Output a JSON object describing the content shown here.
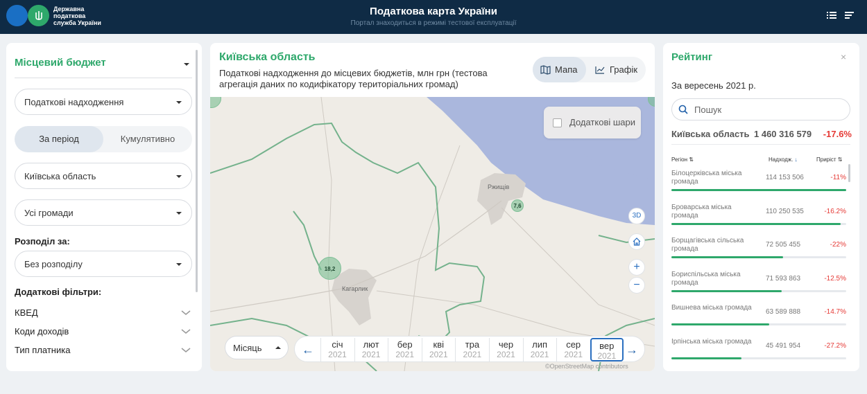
{
  "header": {
    "logo_text": "Державна\nподаткова\nслужба України",
    "title": "Податкова карта України",
    "subtitle": "Портал знаходиться в режимі тестової експлуатації",
    "icons": [
      "trident-icon",
      "list-icon",
      "menu-icon"
    ]
  },
  "left": {
    "budget_label": "Місцевий бюджет",
    "income_select": "Податкові надходження",
    "period_label": "За період",
    "cumulative_label": "Кумулятивно",
    "region_select": "Київська область",
    "communities_select": "Усі громади",
    "split_label": "Розподіл за:",
    "split_select": "Без розподілу",
    "extra_filters_label": "Додаткові фільтри:",
    "filters": [
      "КВЕД",
      "Коди доходів",
      "Тип платника"
    ]
  },
  "center": {
    "title": "Київська область",
    "description": "Податкові надходження до місцевих бюджетів, млн грн (тестова агрегація даних по кодифікатору територіальних громад)",
    "map_label": "Мапа",
    "chart_label": "Графік",
    "extra_layers_label": "Додаткові шари",
    "btn_3d": "3D",
    "zoom_in": "+",
    "zoom_out": "−",
    "clusters": [
      {
        "value": "18,2"
      },
      {
        "value": "7,6"
      }
    ],
    "cities": [
      "Ржищів",
      "Кагарлик"
    ],
    "period_select": "Місяць",
    "months": [
      {
        "m": "січ",
        "y": "2021"
      },
      {
        "m": "лют",
        "y": "2021"
      },
      {
        "m": "бер",
        "y": "2021"
      },
      {
        "m": "кві",
        "y": "2021"
      },
      {
        "m": "тра",
        "y": "2021"
      },
      {
        "m": "чер",
        "y": "2021"
      },
      {
        "m": "лип",
        "y": "2021"
      },
      {
        "m": "сер",
        "y": "2021"
      },
      {
        "m": "вер",
        "y": "2021"
      }
    ],
    "selected_month": "вер",
    "attribution": "©OpenStreetMap contributors",
    "colors": {
      "accent": "#2ea86b",
      "water": "#aab7dd",
      "border": "#74b28c"
    }
  },
  "right": {
    "title": "Рейтинг",
    "close": "×",
    "period": "За вересень 2021 р.",
    "search_placeholder": "Пошук",
    "total": {
      "name": "Київська область",
      "value": "1 460 316 579",
      "growth": "-17.6%"
    },
    "columns": {
      "region": "Регіон",
      "income": "Надходж.",
      "growth": "Приріст"
    },
    "rows": [
      {
        "name": "Білоцерківська міська громада",
        "value": "114 153 506",
        "growth": "-11%",
        "share": 1.0
      },
      {
        "name": "Броварська міська громада",
        "value": "110 250 535",
        "growth": "-16.2%",
        "share": 0.97
      },
      {
        "name": "Борщагівська сільська громада",
        "value": "72 505 455",
        "growth": "-22%",
        "share": 0.64
      },
      {
        "name": "Бориспільська міська громада",
        "value": "71 593 863",
        "growth": "-12.5%",
        "share": 0.63
      },
      {
        "name": "Вишнева міська громада",
        "value": "63 589 888",
        "growth": "-14.7%",
        "share": 0.56
      },
      {
        "name": "Ірпінська міська громада",
        "value": "45 491 954",
        "growth": "-27.2%",
        "share": 0.4
      }
    ]
  }
}
